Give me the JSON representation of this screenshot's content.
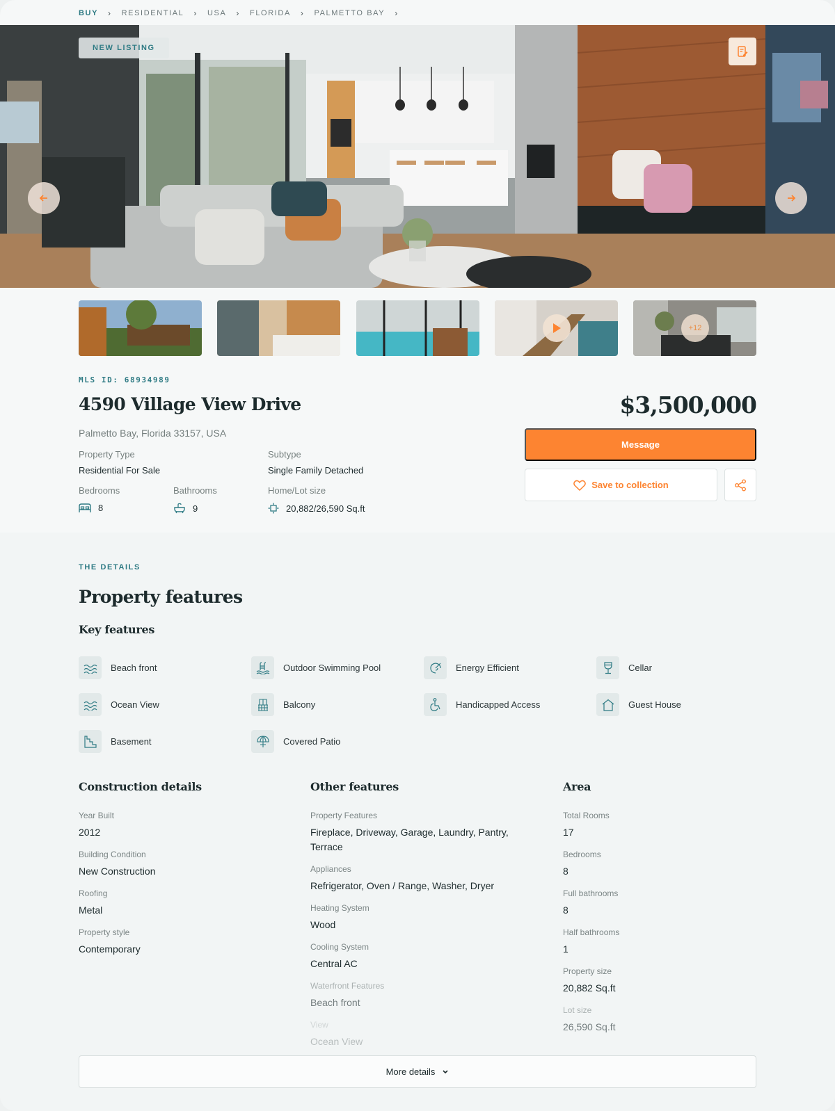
{
  "breadcrumb": [
    "BUY",
    "RESIDENTIAL",
    "USA",
    "FLORIDA",
    "PALMETTO BAY"
  ],
  "hero": {
    "badge": "NEW LISTING"
  },
  "thumbnails": {
    "more_count": "+12"
  },
  "listing": {
    "mls": "MLS ID: 68934989",
    "title": "4590 Village View Drive",
    "address": "Palmetto Bay, Florida 33157, USA",
    "price": "$3,500,000",
    "property_type_label": "Property Type",
    "property_type": "Residential For Sale",
    "subtype_label": "Subtype",
    "subtype": "Single Family Detached",
    "bedrooms_label": "Bedrooms",
    "bedrooms": "8",
    "bathrooms_label": "Bathrooms",
    "bathrooms": "9",
    "lot_label": "Home/Lot size",
    "lot": "20,882/26,590 Sq.ft"
  },
  "actions": {
    "message": "Message",
    "save": "Save to collection"
  },
  "details": {
    "eyebrow": "THE DETAILS",
    "heading": "Property features",
    "key_heading": "Key features",
    "key_features": [
      {
        "label": "Beach front",
        "icon": "waves-icon"
      },
      {
        "label": "Outdoor Swimming Pool",
        "icon": "pool-icon"
      },
      {
        "label": "Energy Efficient",
        "icon": "leaf-icon"
      },
      {
        "label": "Cellar",
        "icon": "wine-glass-icon"
      },
      {
        "label": "Ocean View",
        "icon": "waves-icon"
      },
      {
        "label": "Balcony",
        "icon": "balcony-icon"
      },
      {
        "label": "Handicapped Access",
        "icon": "wheelchair-icon"
      },
      {
        "label": "Guest House",
        "icon": "house-icon"
      },
      {
        "label": "Basement",
        "icon": "stairs-icon"
      },
      {
        "label": "Covered Patio",
        "icon": "umbrella-icon"
      }
    ],
    "construction": {
      "heading": "Construction details",
      "items": [
        {
          "label": "Year Built",
          "value": "2012"
        },
        {
          "label": "Building Condition",
          "value": "New Construction"
        },
        {
          "label": "Roofing",
          "value": "Metal"
        },
        {
          "label": "Property style",
          "value": "Contemporary"
        }
      ]
    },
    "other": {
      "heading": "Other features",
      "items": [
        {
          "label": "Property Features",
          "value": "Fireplace, Driveway, Garage, Laundry, Pantry, Terrace"
        },
        {
          "label": "Appliances",
          "value": "Refrigerator, Oven / Range, Washer, Dryer"
        },
        {
          "label": "Heating System",
          "value": "Wood"
        },
        {
          "label": "Cooling System",
          "value": "Central AC"
        },
        {
          "label": "Waterfront Features",
          "value": "Beach front"
        },
        {
          "label": "View",
          "value": "Ocean View"
        }
      ]
    },
    "area": {
      "heading": "Area",
      "items": [
        {
          "label": "Total Rooms",
          "value": "17"
        },
        {
          "label": "Bedrooms",
          "value": "8"
        },
        {
          "label": "Full bathrooms",
          "value": "8"
        },
        {
          "label": "Half bathrooms",
          "value": "1"
        },
        {
          "label": "Property size",
          "value": "20,882 Sq.ft"
        },
        {
          "label": "Lot size",
          "value": "26,590 Sq.ft"
        }
      ]
    },
    "more_button": "More details"
  },
  "colors": {
    "accent": "#fd8431",
    "teal": "#2f7b84",
    "text": "#1d2b2d"
  }
}
